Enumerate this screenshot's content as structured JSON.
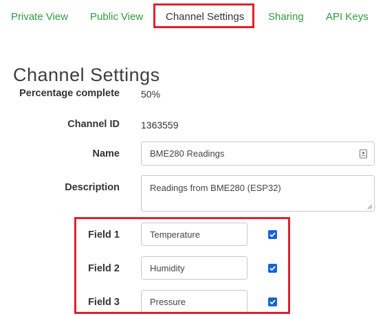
{
  "tabs": [
    {
      "label": "Private View",
      "active": false
    },
    {
      "label": "Public View",
      "active": false
    },
    {
      "label": "Channel Settings",
      "active": true
    },
    {
      "label": "Sharing",
      "active": false
    },
    {
      "label": "API Keys",
      "active": false
    }
  ],
  "page_title": "Channel Settings",
  "percentage": {
    "label": "Percentage complete",
    "value": "50%"
  },
  "channel_id": {
    "label": "Channel ID",
    "value": "1363559"
  },
  "name": {
    "label": "Name",
    "value": "BME280 Readings",
    "icon": "contact-card-icon"
  },
  "description": {
    "label": "Description",
    "value": "Readings from BME280 (ESP32)"
  },
  "fields": [
    {
      "label": "Field 1",
      "value": "Temperature",
      "checked": true
    },
    {
      "label": "Field 2",
      "value": "Humidity",
      "checked": true
    },
    {
      "label": "Field 3",
      "value": "Pressure",
      "checked": true
    }
  ],
  "colors": {
    "tab_link": "#2e9b3f",
    "highlight": "#e0202e",
    "checkbox": "#1565d8"
  }
}
